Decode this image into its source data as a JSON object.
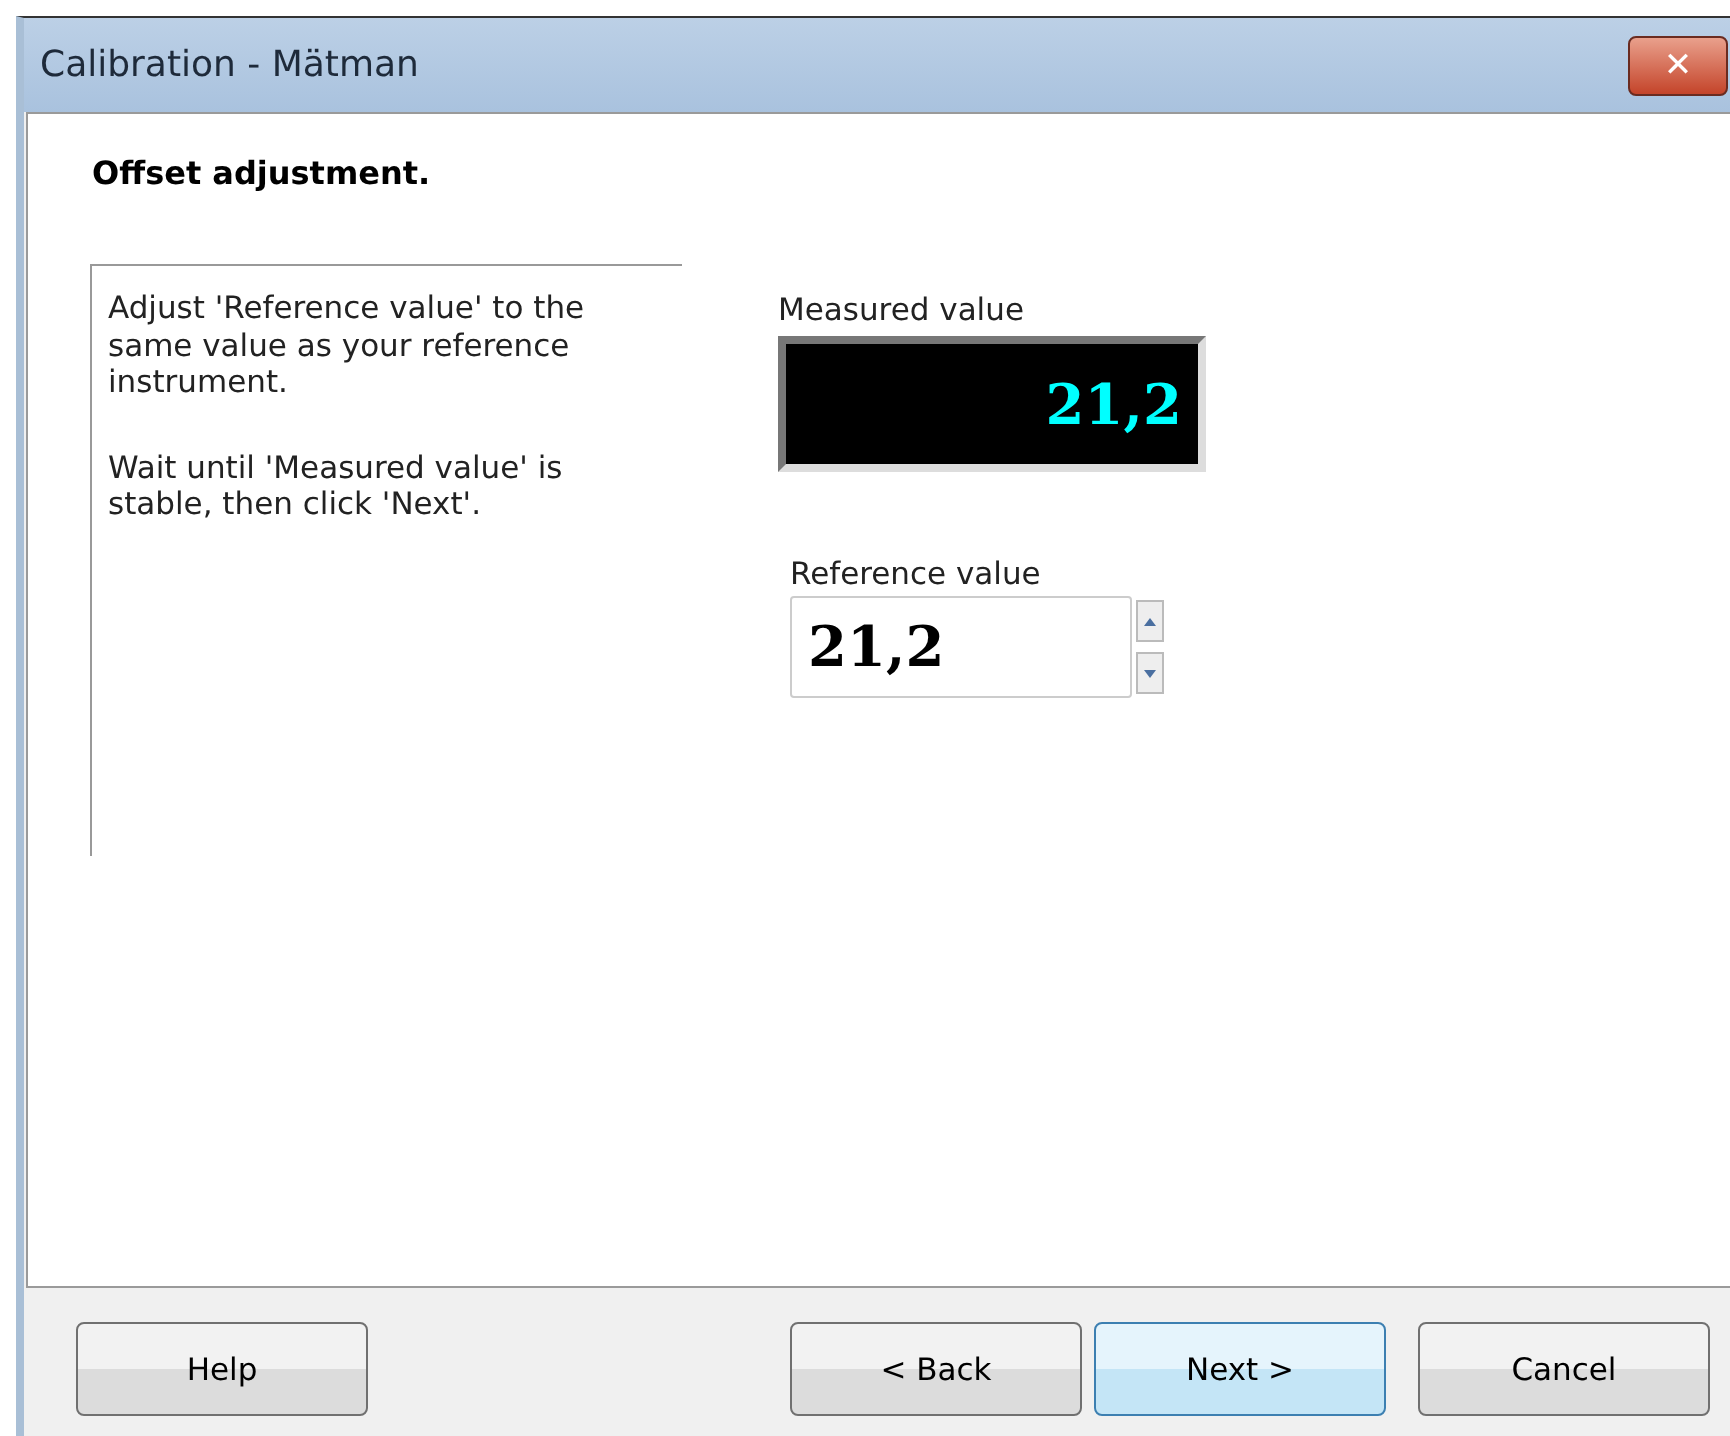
{
  "window": {
    "title": "Calibration - Mätman",
    "close": "✕"
  },
  "heading": "Offset adjustment.",
  "instructions": [
    "Adjust 'Reference value' to the same value as your reference instrument.",
    "Wait until 'Measured value' is stable, then click 'Next'."
  ],
  "measured": {
    "label": "Measured value",
    "value": "21,2"
  },
  "reference": {
    "label": "Reference value",
    "value": "21,2"
  },
  "buttons": [
    {
      "label": "Help",
      "default": false
    },
    {
      "label": "< Back",
      "default": false
    },
    {
      "label": "Next >",
      "default": true
    },
    {
      "label": "Cancel",
      "default": false
    }
  ]
}
